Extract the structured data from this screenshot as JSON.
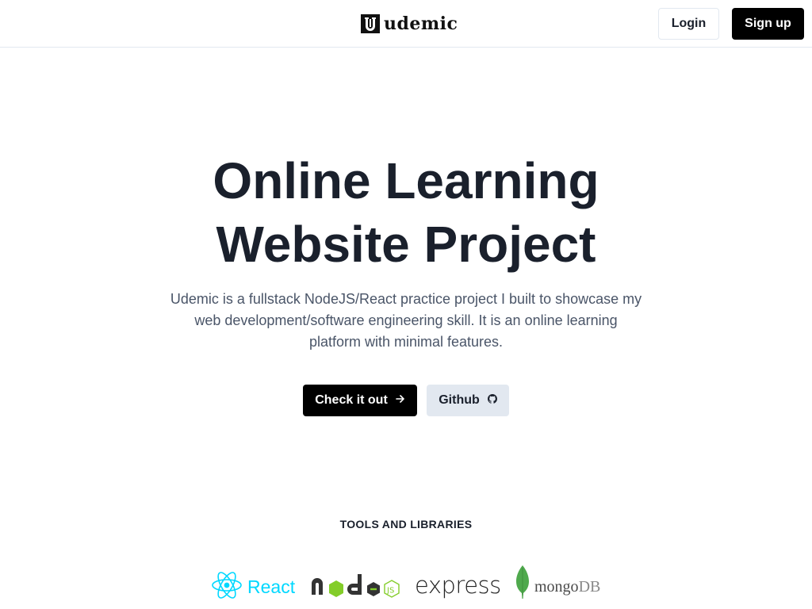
{
  "header": {
    "logo_text": "udemic",
    "login_label": "Login",
    "signup_label": "Sign up"
  },
  "hero": {
    "title_line1": "Online Learning",
    "title_line2": "Website Project",
    "description": "Udemic is a fullstack NodeJS/React practice project I built to showcase my web development/software engineering skill. It is an online learning platform with minimal features.",
    "checkout_label": "Check it out",
    "github_label": "Github"
  },
  "tools": {
    "heading": "TOOLS AND LIBRARIES",
    "items": [
      {
        "name": "React",
        "icon": "react-logo-icon",
        "color": "#00d8ff"
      },
      {
        "name": "node",
        "icon": "nodejs-logo-icon",
        "color": "#83cd29"
      },
      {
        "name": "express",
        "icon": "express-logo-icon",
        "color": "#222222"
      },
      {
        "name": "mongo",
        "suffix": "DB",
        "icon": "mongodb-leaf-icon",
        "color": "#4fa94d"
      }
    ]
  },
  "colors": {
    "primary_button": "#000000",
    "secondary_button": "#e2e8f0",
    "heading": "#1a202c",
    "body_text": "#4a5568"
  }
}
